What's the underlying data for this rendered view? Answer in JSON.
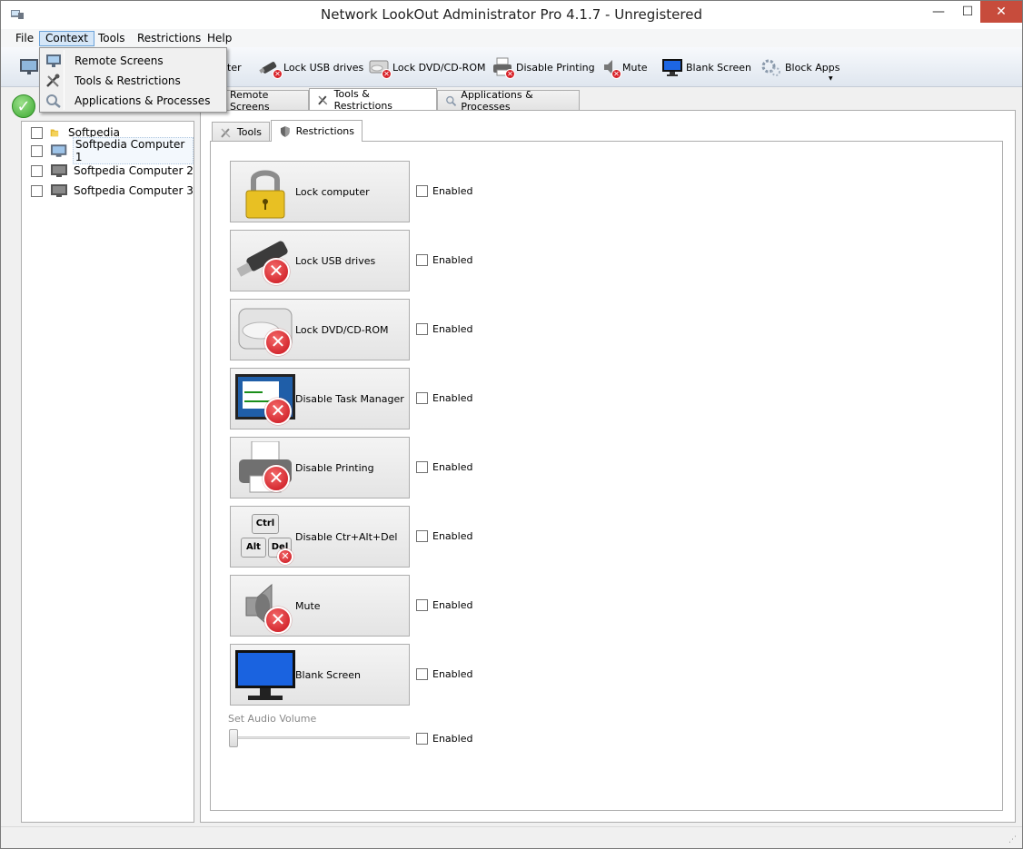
{
  "window": {
    "title": "Network LookOut Administrator Pro 4.1.7 - Unregistered",
    "controls": {
      "minimize": "—",
      "maximize": "☐",
      "close": "✕"
    }
  },
  "menubar": {
    "items": [
      {
        "label": "File"
      },
      {
        "label": "Context"
      },
      {
        "label": "Tools"
      },
      {
        "label": "Restrictions"
      },
      {
        "label": "Help"
      }
    ]
  },
  "context_menu": {
    "items": [
      {
        "label": "Remote Screens",
        "icon": "monitor-icon"
      },
      {
        "label": "Tools & Restrictions",
        "icon": "tools-icon"
      },
      {
        "label": "Applications & Processes",
        "icon": "magnifier-gears-icon"
      }
    ]
  },
  "toolbar": {
    "partial_label": "ter",
    "items": [
      {
        "label": "Lock USB drives",
        "icon": "usb-drive-icon"
      },
      {
        "label": "Lock DVD/CD-ROM",
        "icon": "dvd-drive-icon"
      },
      {
        "label": "Disable Printing",
        "icon": "printer-icon"
      },
      {
        "label": "Mute",
        "icon": "speaker-icon"
      },
      {
        "label": "Blank Screen",
        "icon": "blank-monitor-icon"
      },
      {
        "label": "Block Apps",
        "icon": "gears-icon"
      }
    ]
  },
  "tree": {
    "items": [
      {
        "label": "Softpedia",
        "icon": "folder-icon"
      },
      {
        "label": "Softpedia Computer 1",
        "icon": "computer-icon",
        "selected": true
      },
      {
        "label": "Softpedia Computer 2",
        "icon": "computer-icon"
      },
      {
        "label": "Softpedia Computer 3",
        "icon": "computer-icon"
      }
    ]
  },
  "main_tabs": [
    {
      "label": "Remote Screens"
    },
    {
      "label": "Tools & Restrictions",
      "active": true
    },
    {
      "label": "Applications & Processes"
    }
  ],
  "sub_tabs": [
    {
      "label": "Tools"
    },
    {
      "label": "Restrictions",
      "active": true
    }
  ],
  "restrictions": [
    {
      "label": "Lock computer",
      "icon": "padlock-icon",
      "enabled_label": "Enabled",
      "checked": false
    },
    {
      "label": "Lock USB drives",
      "icon": "usb-drive-icon",
      "enabled_label": "Enabled",
      "checked": false
    },
    {
      "label": "Lock DVD/CD-ROM",
      "icon": "dvd-drive-icon",
      "enabled_label": "Enabled",
      "checked": false
    },
    {
      "label": "Disable Task Manager",
      "icon": "task-manager-icon",
      "enabled_label": "Enabled",
      "checked": false
    },
    {
      "label": "Disable Printing",
      "icon": "printer-icon",
      "enabled_label": "Enabled",
      "checked": false
    },
    {
      "label": "Disable Ctr+Alt+Del",
      "icon": "keyboard-keys-icon",
      "enabled_label": "Enabled",
      "checked": false,
      "keys": [
        "Ctrl",
        "Alt",
        "Del"
      ]
    },
    {
      "label": "Mute",
      "icon": "speaker-icon",
      "enabled_label": "Enabled",
      "checked": false
    },
    {
      "label": "Blank Screen",
      "icon": "blank-monitor-icon",
      "enabled_label": "Enabled",
      "checked": false
    }
  ],
  "audio_volume": {
    "label": "Set Audio Volume",
    "value": 0,
    "enabled_label": "Enabled",
    "checked": false
  },
  "colors": {
    "close_button": "#c74c3c",
    "menu_highlight": "#d5e6f7",
    "error_red": "#d8232a",
    "ok_green": "#3aa82f"
  }
}
